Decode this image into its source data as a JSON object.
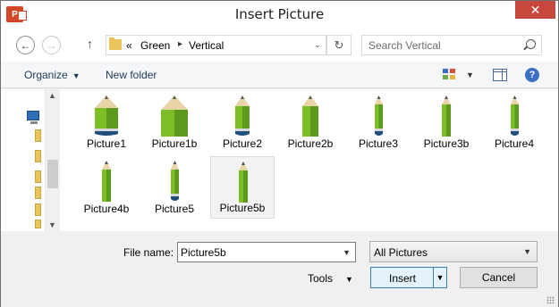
{
  "window": {
    "title": "Insert Picture",
    "app_icon_letter": "P",
    "close_glyph": "✕"
  },
  "address": {
    "back_glyph": "←",
    "forward_glyph": "→",
    "up_glyph": "↑",
    "overflow": "«",
    "crumbs": [
      "Green",
      "Vertical"
    ],
    "separator": "▸",
    "dropdown_glyph": "⌄",
    "refresh_glyph": "↻"
  },
  "search": {
    "placeholder": "Search Vertical"
  },
  "toolbar": {
    "organize_label": "Organize",
    "dropdown_arrow": "▼",
    "new_folder_label": "New folder",
    "help_glyph": "?"
  },
  "navpane": {
    "up_glyph": "▲",
    "down_glyph": "▼"
  },
  "files": [
    {
      "label": "Picture1",
      "style": "wide-eraser"
    },
    {
      "label": "Picture1b",
      "style": "wide"
    },
    {
      "label": "Picture2",
      "style": "medium-eraser"
    },
    {
      "label": "Picture2b",
      "style": "medium"
    },
    {
      "label": "Picture3",
      "style": "thin-eraser"
    },
    {
      "label": "Picture3b",
      "style": "thin"
    },
    {
      "label": "Picture4",
      "style": "thin-eraser"
    },
    {
      "label": "Picture4b",
      "style": "thin"
    },
    {
      "label": "Picture5",
      "style": "thin-eraser"
    },
    {
      "label": "Picture5b",
      "style": "thin",
      "selected": true
    }
  ],
  "colors": {
    "pencil_green": "#7cbd28",
    "pencil_dark": "#5c9a1e",
    "eraser": "#1f4f7a"
  },
  "bottom": {
    "file_name_label": "File name:",
    "file_name_value": "Picture5b",
    "filter_value": "All Pictures",
    "tools_label": "Tools",
    "insert_label": "Insert",
    "cancel_label": "Cancel"
  }
}
